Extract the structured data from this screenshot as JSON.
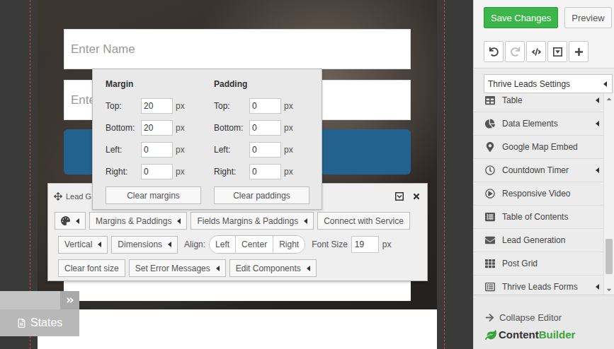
{
  "canvas": {
    "form": {
      "fields": [
        {
          "placeholder": "Enter Name"
        },
        {
          "placeholder": "Ente"
        }
      ]
    }
  },
  "margin_padding_popover": {
    "groups": [
      {
        "title": "Margin",
        "fields": [
          {
            "label": "Top:",
            "value": "20",
            "unit": "px"
          },
          {
            "label": "Bottom:",
            "value": "20",
            "unit": "px"
          },
          {
            "label": "Left:",
            "value": "0",
            "unit": "px"
          },
          {
            "label": "Right:",
            "value": "0",
            "unit": "px"
          }
        ],
        "clear_button": "Clear margins"
      },
      {
        "title": "Padding",
        "fields": [
          {
            "label": "Top:",
            "value": "0",
            "unit": "px"
          },
          {
            "label": "Bottom:",
            "value": "0",
            "unit": "px"
          },
          {
            "label": "Left:",
            "value": "0",
            "unit": "px"
          },
          {
            "label": "Right:",
            "value": "0",
            "unit": "px"
          }
        ],
        "clear_button": "Clear paddings"
      }
    ]
  },
  "element_toolbar": {
    "title": "Lead G",
    "rows": [
      [
        {
          "kind": "icon-menu",
          "dropdown": true
        },
        {
          "kind": "button",
          "label": "Margins & Paddings",
          "dropdown": true
        },
        {
          "kind": "button",
          "label": "Fields Margins & Paddings",
          "dropdown": true
        },
        {
          "kind": "button",
          "label": "Connect with Service",
          "dropdown": false
        }
      ],
      [
        {
          "kind": "button",
          "label": "Vertical",
          "dropdown": true
        },
        {
          "kind": "button",
          "label": "Dimensions",
          "dropdown": true
        },
        {
          "kind": "align",
          "label": "Align:",
          "options": [
            {
              "label": "Left",
              "selected": false
            },
            {
              "label": "Center",
              "selected": false
            },
            {
              "label": "Right",
              "selected": false
            }
          ]
        },
        {
          "kind": "font-size",
          "label": "Font Size",
          "value": "19",
          "unit": "px"
        }
      ],
      [
        {
          "kind": "button",
          "label": "Clear font size",
          "dropdown": false
        },
        {
          "kind": "button",
          "label": "Set Error Messages",
          "dropdown": true
        },
        {
          "kind": "button",
          "label": "Edit Components",
          "dropdown": true
        }
      ]
    ]
  },
  "states_panel": {
    "label": "States"
  },
  "sidebar": {
    "save_button": "Save Changes",
    "preview_button": "Preview",
    "settings_dropdown": "Thrive Leads Settings",
    "items": [
      {
        "label": "Table",
        "dropdown": true
      },
      {
        "label": "Data Elements",
        "dropdown": true
      },
      {
        "label": "Google Map Embed",
        "dropdown": false
      },
      {
        "label": "Countdown Timer",
        "dropdown": true
      },
      {
        "label": "Responsive Video",
        "dropdown": false
      },
      {
        "label": "Table of Contents",
        "dropdown": false
      },
      {
        "label": "Lead Generation",
        "dropdown": false
      },
      {
        "label": "Post Grid",
        "dropdown": false
      },
      {
        "label": "Thrive Leads Forms",
        "dropdown": true
      }
    ],
    "scrollbar": {
      "level": 0.93
    },
    "collapse": "Collapse Editor",
    "logo": {
      "dark": "Content",
      "green": "Builder"
    }
  }
}
